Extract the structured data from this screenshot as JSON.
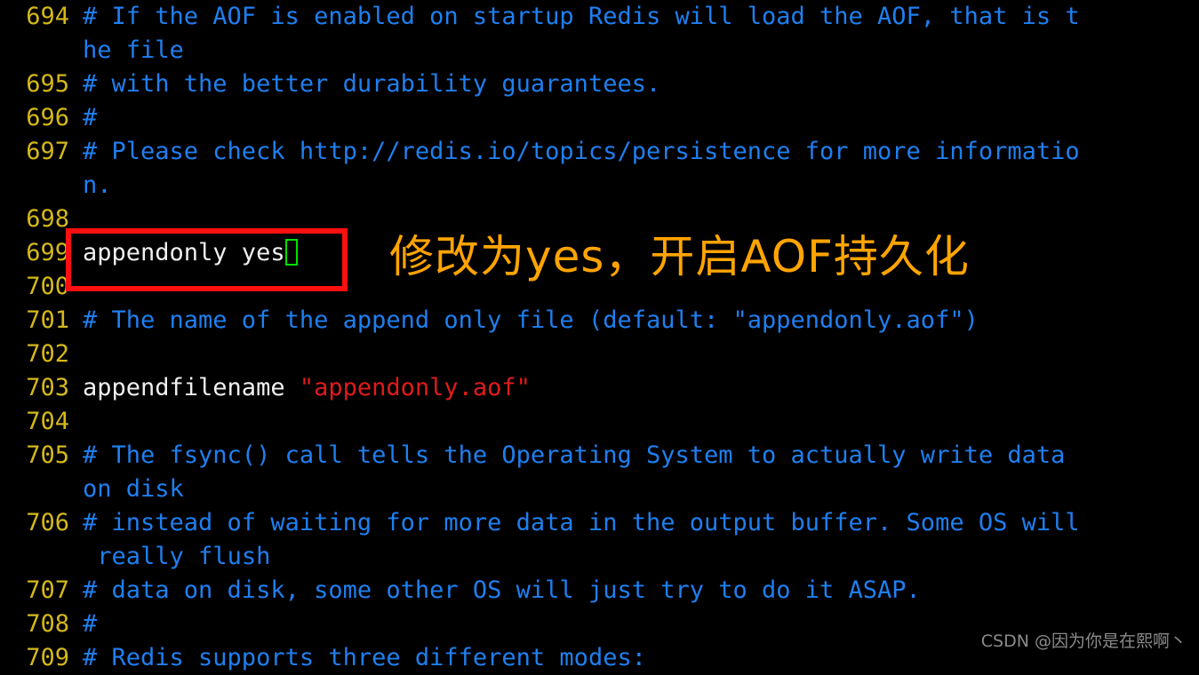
{
  "editor": {
    "background_color": "#000000",
    "line_number_color": "#d4b81a",
    "comment_color": "#1f7fef",
    "plain_text_color": "#f0f0f0",
    "string_color": "#e01b1b",
    "cursor_color": "#00e000",
    "lines": [
      {
        "number": "694",
        "segments": [
          {
            "kind": "comment",
            "text": "# If the AOF is enabled on startup Redis will load the AOF, that is t"
          }
        ],
        "wrap": [
          {
            "kind": "comment",
            "text": "he file"
          }
        ]
      },
      {
        "number": "695",
        "segments": [
          {
            "kind": "comment",
            "text": "# with the better durability guarantees."
          }
        ]
      },
      {
        "number": "696",
        "segments": [
          {
            "kind": "comment",
            "text": "#"
          }
        ]
      },
      {
        "number": "697",
        "segments": [
          {
            "kind": "comment",
            "text": "# Please check http://redis.io/topics/persistence for more informatio"
          }
        ],
        "wrap": [
          {
            "kind": "comment",
            "text": "n."
          }
        ]
      },
      {
        "number": "698",
        "segments": []
      },
      {
        "number": "699",
        "segments": [
          {
            "kind": "plain",
            "text": "appendonly yes"
          }
        ],
        "cursor": true
      },
      {
        "number": "700",
        "segments": []
      },
      {
        "number": "701",
        "segments": [
          {
            "kind": "comment",
            "text": "# The name of the append only file (default: \"appendonly.aof\")"
          }
        ]
      },
      {
        "number": "702",
        "segments": []
      },
      {
        "number": "703",
        "segments": [
          {
            "kind": "plain",
            "text": "appendfilename "
          },
          {
            "kind": "string",
            "text": "\"appendonly.aof\""
          }
        ]
      },
      {
        "number": "704",
        "segments": []
      },
      {
        "number": "705",
        "segments": [
          {
            "kind": "comment",
            "text": "# The fsync() call tells the Operating System to actually write data"
          }
        ],
        "wrap": [
          {
            "kind": "comment",
            "text": "on disk"
          }
        ]
      },
      {
        "number": "706",
        "segments": [
          {
            "kind": "comment",
            "text": "# instead of waiting for more data in the output buffer. Some OS will"
          }
        ],
        "wrap": [
          {
            "kind": "comment",
            "text": " really flush"
          }
        ]
      },
      {
        "number": "707",
        "segments": [
          {
            "kind": "comment",
            "text": "# data on disk, some other OS will just try to do it ASAP."
          }
        ]
      },
      {
        "number": "708",
        "segments": [
          {
            "kind": "comment",
            "text": "#"
          }
        ]
      },
      {
        "number": "709",
        "segments": [
          {
            "kind": "comment",
            "text": "# Redis supports three different modes:"
          }
        ]
      }
    ]
  },
  "annotations": {
    "highlight_box": {
      "color": "#ff1010",
      "targets_line": "699"
    },
    "caption": {
      "text": "修改为yes，开启AOF持久化",
      "color": "#ffa400"
    }
  },
  "watermark": {
    "text": "CSDN @因为你是在熙啊丶",
    "color": "#8a8a8a"
  }
}
